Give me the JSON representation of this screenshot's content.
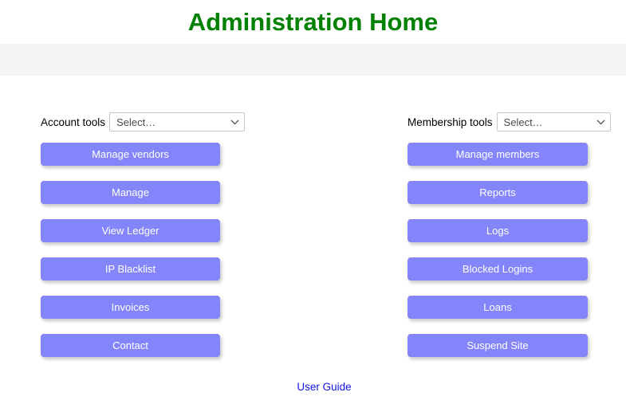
{
  "header": {
    "title": "Administration Home",
    "title_color": "#008000",
    "band_color": "#f4f4f4"
  },
  "theme": {
    "button_bg": "#8585fb",
    "button_text": "#ffffff",
    "link_color": "#1414ec",
    "page_bg": "#ffffff"
  },
  "panels": {
    "account": {
      "label": "Account tools",
      "select": {
        "value": "Select…",
        "placeholder": "Select…",
        "icon": "chevron-down-icon"
      },
      "buttons": [
        {
          "label": "Manage vendors",
          "name": "manage-vendors-button"
        },
        {
          "label": "Manage",
          "name": "manage-button"
        },
        {
          "label": "View Ledger",
          "name": "view-ledger-button"
        },
        {
          "label": "IP Blacklist",
          "name": "ip-blacklist-button"
        },
        {
          "label": "Invoices",
          "name": "invoices-button"
        },
        {
          "label": "Contact",
          "name": "contact-button"
        }
      ]
    },
    "membership": {
      "label": "Membership tools",
      "select": {
        "value": "Select…",
        "placeholder": "Select…",
        "icon": "chevron-down-icon"
      },
      "buttons": [
        {
          "label": "Manage members",
          "name": "manage-members-button"
        },
        {
          "label": "Reports",
          "name": "reports-button"
        },
        {
          "label": "Logs",
          "name": "logs-button"
        },
        {
          "label": "Blocked Logins",
          "name": "blocked-logins-button"
        },
        {
          "label": "Loans",
          "name": "loans-button"
        },
        {
          "label": "Suspend Site",
          "name": "suspend-site-button"
        }
      ]
    }
  },
  "footer": {
    "user_guide_label": "User Guide"
  }
}
